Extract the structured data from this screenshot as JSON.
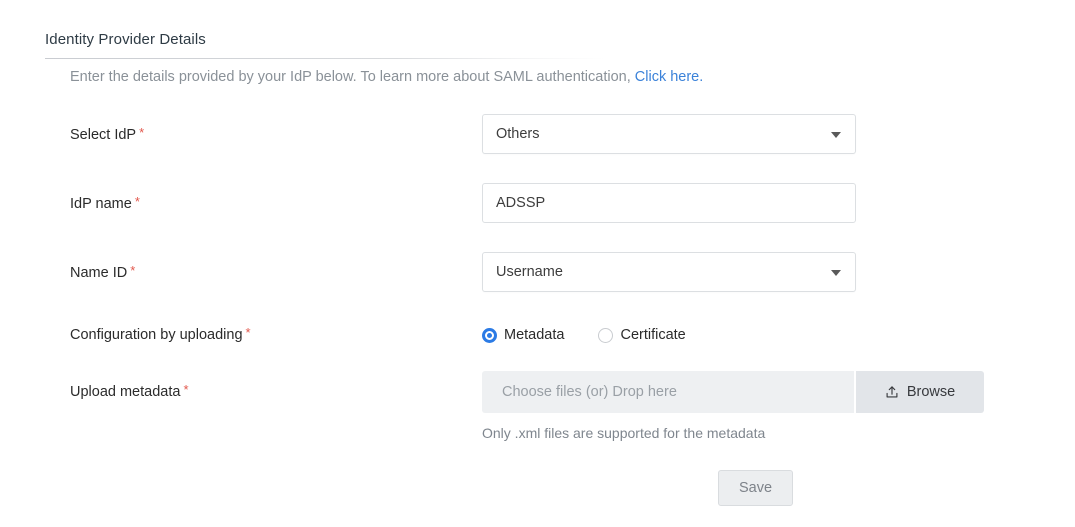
{
  "section": {
    "title": "Identity Provider Details",
    "intro_prefix": "Enter the details provided by your IdP below. To learn more about SAML authentication, ",
    "intro_link": "Click here.",
    "link_color": "#3b82d9"
  },
  "fields": {
    "select_idp": {
      "label": "Select IdP",
      "required_marker": "*",
      "value": "Others",
      "icon": "chevron-down-icon"
    },
    "idp_name": {
      "label": "IdP name",
      "required_marker": "*",
      "value": "ADSSP",
      "placeholder": ""
    },
    "name_id": {
      "label": "Name ID",
      "required_marker": "*",
      "value": "Username",
      "icon": "chevron-down-icon"
    },
    "config_upload": {
      "label": "Configuration by uploading",
      "required_marker": "*",
      "options": [
        {
          "label": "Metadata",
          "selected": true
        },
        {
          "label": "Certificate",
          "selected": false
        }
      ],
      "selected_color": "#2c7be5"
    },
    "upload_metadata": {
      "label": "Upload metadata",
      "required_marker": "*",
      "drop_placeholder": "Choose files (or) Drop here",
      "browse_label": "Browse",
      "browse_icon": "upload-icon",
      "hint": "Only .xml files are supported for the metadata"
    }
  },
  "actions": {
    "save_label": "Save"
  }
}
